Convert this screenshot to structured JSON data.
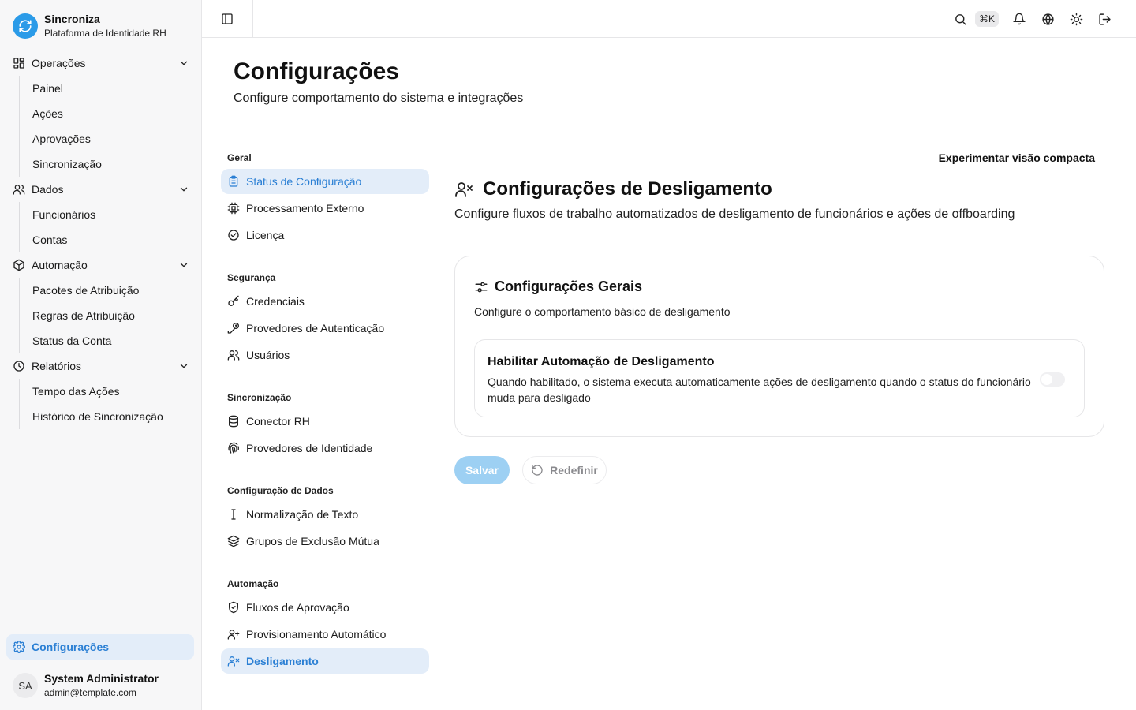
{
  "brand": {
    "name": "Sincroniza",
    "subtitle": "Plataforma de Identidade RH",
    "color": "#2b9be8"
  },
  "sidebar": {
    "groups": [
      {
        "label": "Operações",
        "icon": "dashboard-grid-icon",
        "items": [
          "Painel",
          "Ações",
          "Aprovações",
          "Sincronização"
        ]
      },
      {
        "label": "Dados",
        "icon": "users-icon",
        "items": [
          "Funcionários",
          "Contas"
        ]
      },
      {
        "label": "Automação",
        "icon": "package-icon",
        "items": [
          "Pacotes de Atribuição",
          "Regras de Atribuição",
          "Status da Conta"
        ]
      },
      {
        "label": "Relatórios",
        "icon": "clock-icon",
        "items": [
          "Tempo das Ações",
          "Histórico de Sincronização"
        ]
      }
    ],
    "settings_label": "Configurações"
  },
  "user": {
    "initials": "SA",
    "name": "System Administrator",
    "email": "admin@template.com"
  },
  "topbar": {
    "shortcut": "⌘K"
  },
  "page": {
    "title": "Configurações",
    "subtitle": "Configure comportamento do sistema e integrações"
  },
  "settings_nav": {
    "sections": [
      {
        "title": "Geral",
        "items": [
          {
            "label": "Status de Configuração",
            "icon": "clipboard-icon",
            "active": true
          },
          {
            "label": "Processamento Externo",
            "icon": "cpu-icon"
          },
          {
            "label": "Licença",
            "icon": "check-circle-icon"
          }
        ]
      },
      {
        "title": "Segurança",
        "items": [
          {
            "label": "Credenciais",
            "icon": "key-icon"
          },
          {
            "label": "Provedores de Autenticação",
            "icon": "key-round-icon"
          },
          {
            "label": "Usuários",
            "icon": "users-icon"
          }
        ]
      },
      {
        "title": "Sincronização",
        "items": [
          {
            "label": "Conector RH",
            "icon": "database-icon"
          },
          {
            "label": "Provedores de Identidade",
            "icon": "fingerprint-icon"
          }
        ]
      },
      {
        "title": "Configuração de Dados",
        "items": [
          {
            "label": "Normalização de Texto",
            "icon": "text-cursor-icon"
          },
          {
            "label": "Grupos de Exclusão Mútua",
            "icon": "layers-icon"
          }
        ]
      },
      {
        "title": "Automação",
        "items": [
          {
            "label": "Fluxos de Aprovação",
            "icon": "shield-check-icon"
          },
          {
            "label": "Provisionamento Automático",
            "icon": "user-plus-icon"
          },
          {
            "label": "Desligamento",
            "icon": "user-x-icon",
            "active": true
          }
        ]
      }
    ]
  },
  "content": {
    "compact_link": "Experimentar visão compacta",
    "title": "Configurações de Desligamento",
    "description": "Configure fluxos de trabalho automatizados de desligamento de funcionários e ações de offboarding",
    "card": {
      "title": "Configurações Gerais",
      "description": "Configure o comportamento básico de desligamento",
      "setting": {
        "title": "Habilitar Automação de Desligamento",
        "description": "Quando habilitado, o sistema executa automaticamente ações de desligamento quando o status do funcionário muda para desligado",
        "enabled": false
      }
    },
    "save_label": "Salvar",
    "reset_label": "Redefinir"
  },
  "colors": {
    "accent": "#2a7fd4",
    "active_bg": "#e3edf9",
    "save_disabled": "#9dd0f3"
  }
}
